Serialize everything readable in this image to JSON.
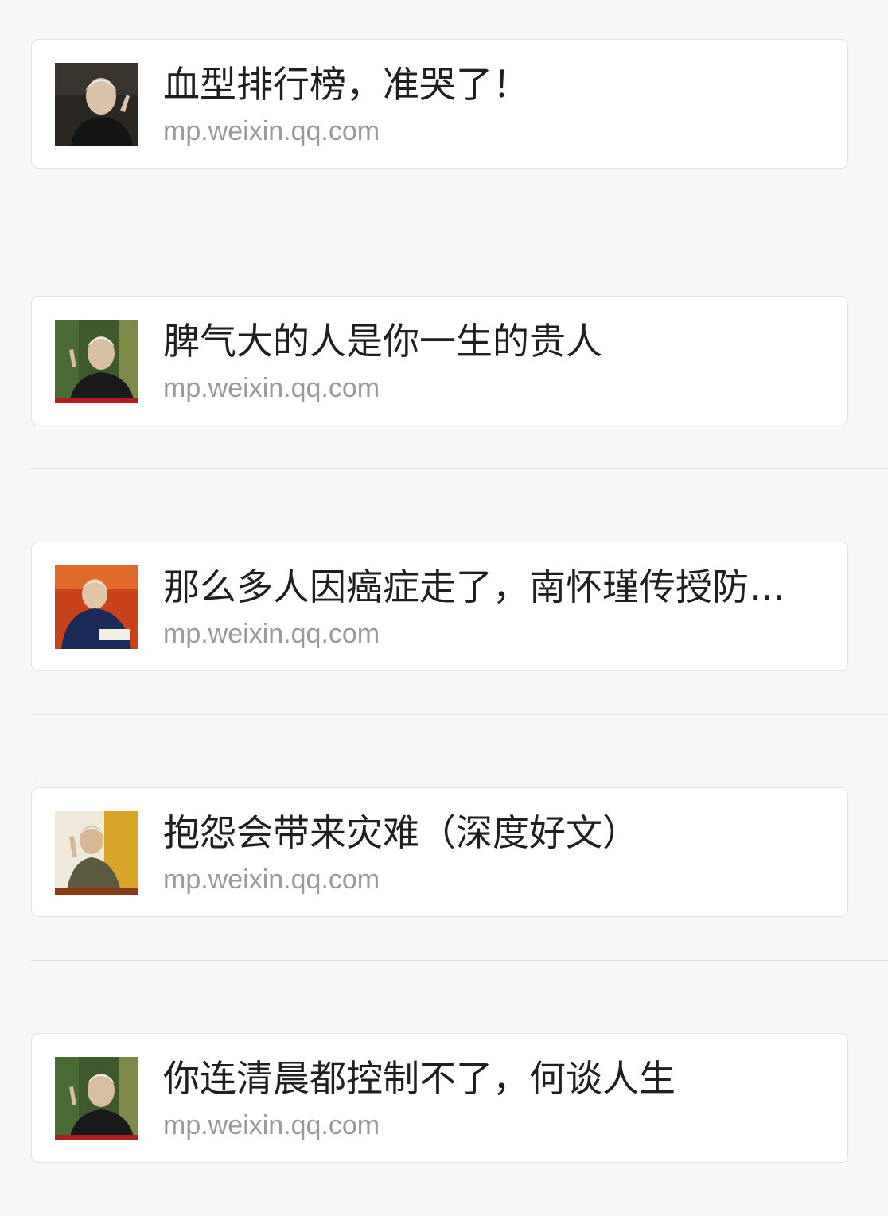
{
  "articles": [
    {
      "title": "血型排行榜，准哭了！",
      "source": "mp.weixin.qq.com",
      "thumb_icon": "portrait-elderly-man-dark-background"
    },
    {
      "title": "脾气大的人是你一生的贵人",
      "source": "mp.weixin.qq.com",
      "thumb_icon": "portrait-elderly-man-speaking-green-background"
    },
    {
      "title": "那么多人因癌症走了，南怀瑾传授防…",
      "source": "mp.weixin.qq.com",
      "thumb_icon": "portrait-elderly-man-reading-red-background"
    },
    {
      "title": "抱怨会带来灾难（深度好文）",
      "source": "mp.weixin.qq.com",
      "thumb_icon": "portrait-elderly-man-gesturing-yellow-background"
    },
    {
      "title": "你连清晨都控制不了，何谈人生",
      "source": "mp.weixin.qq.com",
      "thumb_icon": "portrait-elderly-man-speaking-green-background"
    }
  ]
}
